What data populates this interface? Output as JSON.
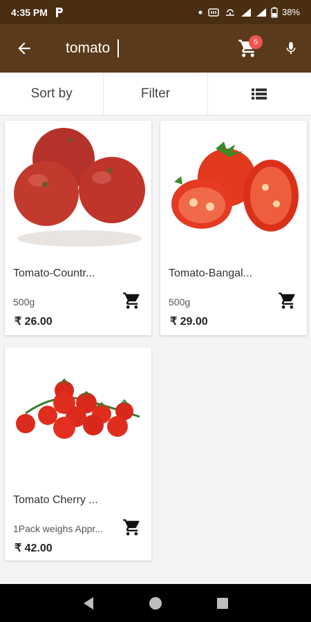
{
  "status_bar": {
    "time": "4:35 PM",
    "battery": "38%"
  },
  "app_bar": {
    "search_value": "tomato",
    "cart_badge": "5"
  },
  "toolbar": {
    "sort_label": "Sort by",
    "filter_label": "Filter"
  },
  "products": [
    {
      "name": "Tomato-Countr...",
      "qty": "500g",
      "price": "₹ 26.00"
    },
    {
      "name": "Tomato-Bangal...",
      "qty": "500g",
      "price": "₹ 29.00"
    },
    {
      "name": "Tomato Cherry  ...",
      "qty": "1Pack weighs Appr...",
      "price": "₹ 42.00"
    }
  ],
  "colors": {
    "app_bar": "#5a3a1a",
    "status_bar": "#4a2e12",
    "badge": "#ef5350"
  }
}
